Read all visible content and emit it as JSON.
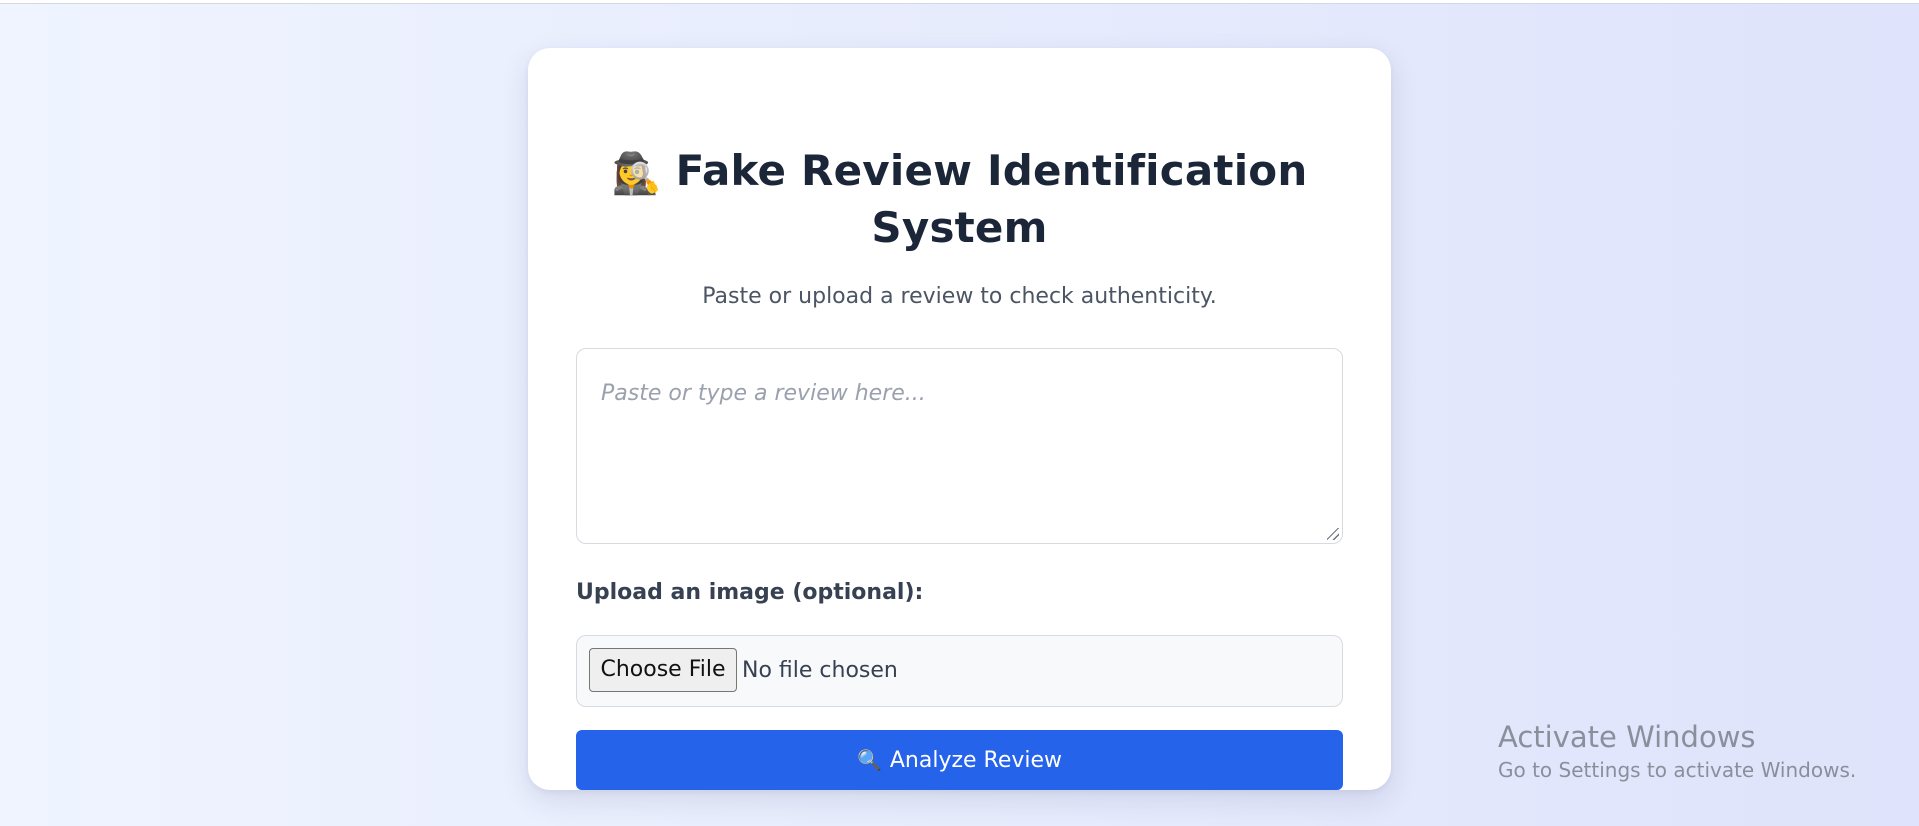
{
  "app": {
    "title": "Fake Review Identification System",
    "title_icon": "detective-icon",
    "subtitle": "Paste or upload a review to check authenticity."
  },
  "review_input": {
    "value": "",
    "placeholder": "Paste or type a review here..."
  },
  "upload": {
    "label": "Upload an image (optional):",
    "button_label": "Choose File",
    "status": "No file chosen"
  },
  "analyze_button": {
    "icon": "magnifier-icon",
    "label": "Analyze Review",
    "color": "#2563eb"
  },
  "watermark": {
    "title": "Activate Windows",
    "subtitle": "Go to Settings to activate Windows."
  },
  "colors": {
    "title_text": "#1b2638",
    "page_bg_start": "#eff4ff",
    "page_bg_end": "#dfe3fb"
  }
}
